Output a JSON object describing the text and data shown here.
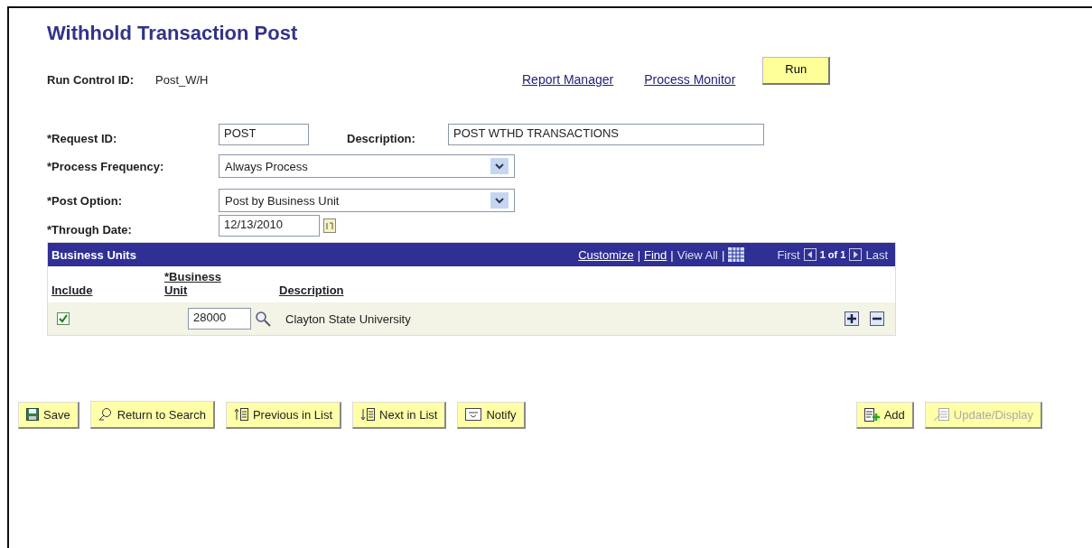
{
  "title": "Withhold Transaction Post",
  "run_control": {
    "label": "Run Control ID:",
    "value": "Post_W/H"
  },
  "links": [
    "Report Manager",
    "Process Monitor"
  ],
  "run_button": "Run",
  "request": {
    "label": "*Request ID:",
    "value": "POST",
    "description_label": "Description:",
    "description_value": "POST WTHD TRANSACTIONS"
  },
  "selects": [
    {
      "label": "*Process Frequency:",
      "value": "Always Process"
    },
    {
      "label": "*Post Option:",
      "value": "Post by Business Unit"
    }
  ],
  "through_date": {
    "label": "*Through Date:",
    "value": "12/13/2010"
  },
  "grid": {
    "title": "Business Units",
    "links": [
      "Customize",
      "Find"
    ],
    "view_all": "View All",
    "first": "First",
    "count": "1 of 1",
    "last": "Last",
    "separator": "|",
    "columns": [
      "Include",
      "*Business Unit",
      "Description"
    ],
    "rows": [
      {
        "include": true,
        "unit": "28000",
        "description": "Clayton State University"
      }
    ]
  },
  "buttons": [
    {
      "label": "Save",
      "kind": "save",
      "disabled": false
    },
    {
      "label": "Return to Search",
      "kind": "return",
      "disabled": false
    },
    {
      "label": "Previous in List",
      "kind": "previous",
      "disabled": false
    },
    {
      "label": "Next in List",
      "kind": "next",
      "disabled": false
    },
    {
      "label": "Notify",
      "kind": "notify",
      "disabled": false
    }
  ],
  "right_buttons": [
    {
      "label": "Add",
      "kind": "add",
      "disabled": false
    },
    {
      "label": "Update/Display",
      "kind": "update",
      "disabled": true
    }
  ]
}
